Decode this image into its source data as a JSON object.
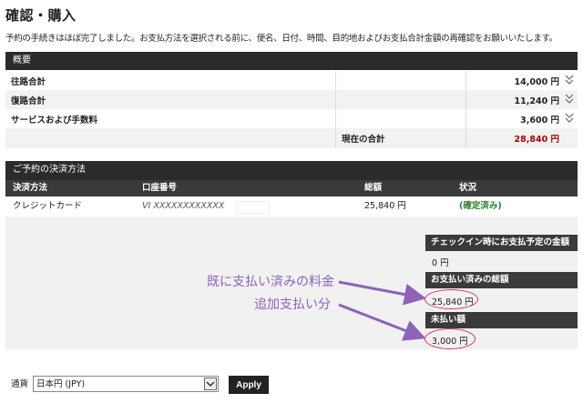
{
  "page": {
    "title": "確認・購入",
    "intro": "予約の手続きはほぼ完了しました。お支払方法を選択される前に、便名、日付、時間、目的地およびお支払合計金額の再確認をお願いいたします。"
  },
  "summary": {
    "header": "概要",
    "rows": [
      {
        "label": "往路合計",
        "amount": "14,000 円"
      },
      {
        "label": "復路合計",
        "amount": "11,240 円"
      },
      {
        "label": "サービスおよび手数料",
        "amount": "3,600 円"
      }
    ],
    "total_label": "現在の合計",
    "total_amount": "28,840 円"
  },
  "payment": {
    "header": "ご予約の決済方法",
    "columns": [
      "決済方法",
      "口座番号",
      "総額",
      "状況"
    ],
    "row": {
      "method": "クレジットカード",
      "account": "VI XXXXXXXXXXXX",
      "total": "25,840 円",
      "status": "(確定済み)"
    }
  },
  "checkin": {
    "label": "チェックイン時にお支払予定の金額",
    "value": "0 円"
  },
  "paid": {
    "label": "お支払い済みの総額",
    "value": "25,840 円"
  },
  "unpaid": {
    "label": "未払い額",
    "value": "3,000 円"
  },
  "annotations": {
    "paid_note": "既に支払い済みの料金",
    "extra_note": "追加支払い分"
  },
  "currency": {
    "label": "通貨",
    "selected": "日本円 (JPY)",
    "apply_label": "Apply"
  },
  "colors": {
    "annotation": "#8e63b8",
    "highlight": "#d8326a",
    "total": "#aa0000",
    "status": "#2e7d32"
  }
}
